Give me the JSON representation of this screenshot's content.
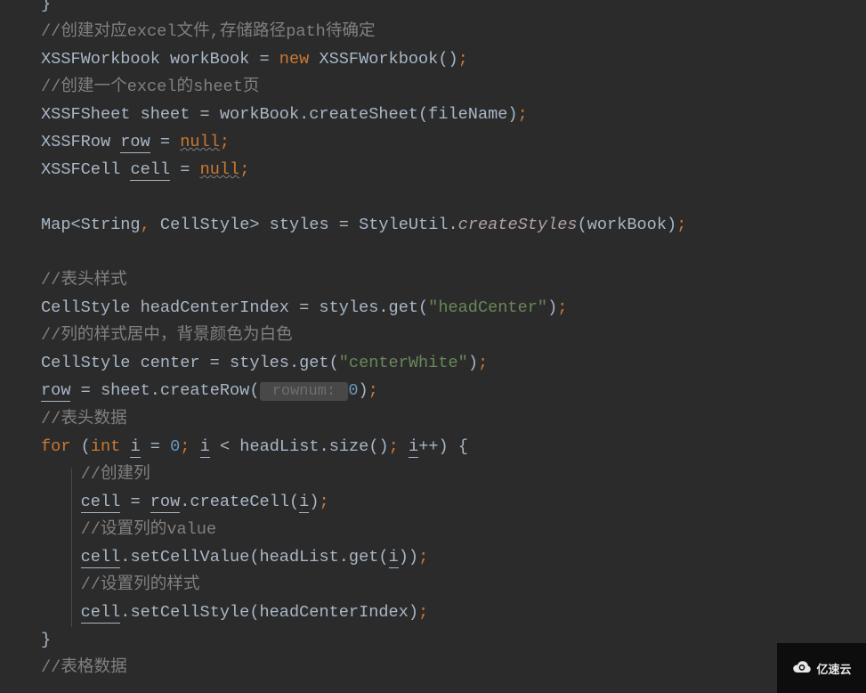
{
  "code": {
    "line1": "}",
    "line2": "//创建对应excel文件,存储路径path待确定",
    "line3_a": "XSSFWorkbook workBook = ",
    "line3_new": "new",
    "line3_b": " XSSFWorkbook()",
    "line3_sc": ";",
    "line4": "//创建一个excel的sheet页",
    "line5_a": "XSSFSheet sheet = workBook.createSheet(fileName)",
    "line5_sc": ";",
    "line6_a": "XSSFRow ",
    "line6_row": "row",
    "line6_b": " = ",
    "line6_null": "null",
    "line6_sc": ";",
    "line7_a": "XSSFCell ",
    "line7_cell": "cell",
    "line7_b": " = ",
    "line7_null": "null",
    "line7_sc": ";",
    "line9_a": "Map<String",
    "line9_c1": ",",
    "line9_b": " CellStyle> styles = StyleUtil.",
    "line9_m": "createStyles",
    "line9_c": "(workBook)",
    "line9_sc": ";",
    "line11": "//表头样式",
    "line12_a": "CellStyle headCenterIndex = styles.get(",
    "line12_str": "\"headCenter\"",
    "line12_b": ")",
    "line12_sc": ";",
    "line13": "//列的样式居中，背景颜色为白色",
    "line14_a": "CellStyle center = styles.get(",
    "line14_str": "\"centerWhite\"",
    "line14_b": ")",
    "line14_sc": ";",
    "line15_row": "row",
    "line15_a": " = sheet.createRow(",
    "line15_hint": " rownum: ",
    "line15_num": "0",
    "line15_b": ")",
    "line15_sc": ";",
    "line16": "//表头数据",
    "line17_for": "for",
    "line17_a": " (",
    "line17_int": "int",
    "line17_sp": " ",
    "line17_i1": "i",
    "line17_b": " = ",
    "line17_z": "0",
    "line17_sc1": ";",
    "line17_c": " ",
    "line17_i2": "i",
    "line17_d": " < headList.size()",
    "line17_sc2": ";",
    "line17_e": " ",
    "line17_i3": "i",
    "line17_f": "++) {",
    "line18": "//创建列",
    "line19_cell": "cell",
    "line19_a": " = ",
    "line19_row": "row",
    "line19_b": ".createCell(",
    "line19_i": "i",
    "line19_c": ")",
    "line19_sc": ";",
    "line20": "//设置列的value",
    "line21_cell": "cell",
    "line21_a": ".setCellValue(headList.get(",
    "line21_i": "i",
    "line21_b": "))",
    "line21_sc": ";",
    "line22": "//设置列的样式",
    "line23_cell": "cell",
    "line23_a": ".setCellStyle(headCenterIndex)",
    "line23_sc": ";",
    "line24": "}",
    "line25": "//表格数据"
  },
  "watermark": {
    "text": "亿速云"
  }
}
